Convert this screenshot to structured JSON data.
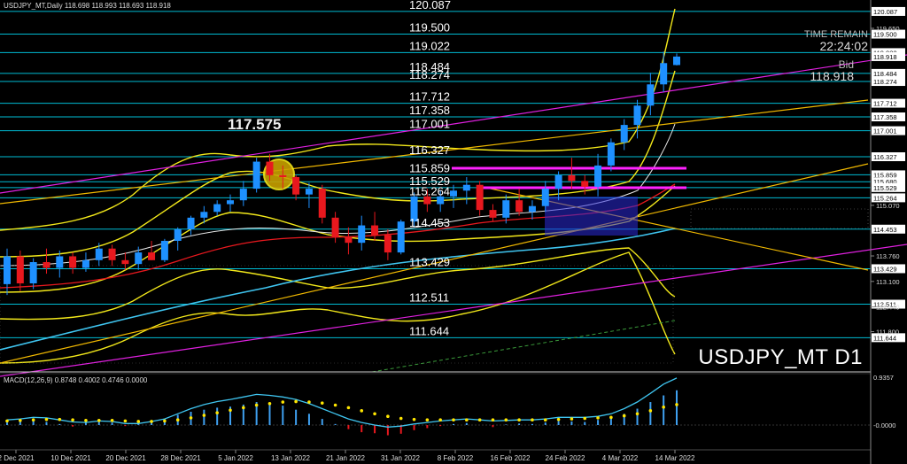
{
  "header": {
    "symbol_info": "USDJPY_MT,Daily  118.698 118.993 118.693 118.918"
  },
  "timer": {
    "label": "TIME REMAIN",
    "value": "22:24:02"
  },
  "bid": {
    "label": "Bid",
    "value": "118.918"
  },
  "watermark": "USDJPY_MT D1",
  "annotations": {
    "high_label": "117.575"
  },
  "macd": {
    "label": "MACD(12,26,9) 0.8748 0.4002 0.4746 0.0000",
    "top_value": "0.9357",
    "zero_value": "-0.0000"
  },
  "colors": {
    "background": "#000000",
    "bull_candle": "#1e90ff",
    "bear_candle": "#e8181e",
    "level_line": "#00bcd4",
    "bollinger": "#f2e81a",
    "trend_magenta": "#e020e0",
    "trend_orange": "#f0b800",
    "macd_signal": "#ffe600",
    "macd_line": "#3fc5f0",
    "price_scale_bg": "#ffffff"
  },
  "chart_data": {
    "type": "candlestick",
    "timeframe": "Daily",
    "symbol": "USDJPY_MT",
    "ylim": [
      110.85,
      120.2
    ],
    "horizontal_levels": [
      {
        "price": 120.087,
        "label": "120.087",
        "scale": "120.087"
      },
      {
        "price": 119.5,
        "label": "119.500",
        "scale": "119.500"
      },
      {
        "price": 119.022,
        "label": "119.022",
        "scale": "119.022"
      },
      {
        "price": 118.484,
        "label": "118.484",
        "scale": "118.484"
      },
      {
        "price": 118.274,
        "label": "118.274",
        "scale": "118.274"
      },
      {
        "price": 117.712,
        "label": "117.712",
        "scale": "117.712"
      },
      {
        "price": 117.358,
        "label": "117.358",
        "scale": "117.358"
      },
      {
        "price": 117.001,
        "label": "117.001",
        "scale": "117.001"
      },
      {
        "price": 116.327,
        "label": "116.327",
        "scale": "116.327"
      },
      {
        "price": 115.859,
        "label": "115.859",
        "scale": "115.859"
      },
      {
        "price": 115.68,
        "label": "",
        "scale": "115.680"
      },
      {
        "price": 115.529,
        "label": "115.529",
        "scale": "115.529"
      },
      {
        "price": 115.264,
        "label": "115.264",
        "scale": "115.264"
      },
      {
        "price": 114.453,
        "label": "114.453",
        "scale": "114.453"
      },
      {
        "price": 113.429,
        "label": "113.429",
        "scale": "113.429"
      },
      {
        "price": 112.511,
        "label": "112.511",
        "scale": "112.511"
      },
      {
        "price": 111.644,
        "label": "111.644",
        "scale": "111.644"
      }
    ],
    "plain_scale_ticks": [
      {
        "price": 119.65,
        "label": "119.650"
      },
      {
        "price": 115.07,
        "label": "115.070"
      },
      {
        "price": 113.76,
        "label": "113.760"
      },
      {
        "price": 113.1,
        "label": "113.100"
      },
      {
        "price": 112.44,
        "label": "112.440"
      },
      {
        "price": 111.8,
        "label": "111.800"
      }
    ],
    "current_price": {
      "price": 118.918,
      "label": "118.918"
    },
    "x_labels": [
      "2 Dec 2021",
      "10 Dec 2021",
      "20 Dec 2021",
      "28 Dec 2021",
      "5 Jan 2022",
      "13 Jan 2022",
      "21 Jan 2022",
      "31 Jan 2022",
      "8 Feb 2022",
      "16 Feb 2022",
      "24 Feb 2022",
      "4 Mar 2022",
      "14 Mar 2022"
    ],
    "candles": [
      [
        113.03,
        113.95,
        112.75,
        113.75
      ],
      [
        113.75,
        113.9,
        112.85,
        113.05
      ],
      [
        113.05,
        113.7,
        112.9,
        113.6
      ],
      [
        113.6,
        113.95,
        113.3,
        113.45
      ],
      [
        113.45,
        113.9,
        113.2,
        113.75
      ],
      [
        113.75,
        113.85,
        113.3,
        113.45
      ],
      [
        113.45,
        113.85,
        113.35,
        113.65
      ],
      [
        113.65,
        114.1,
        113.5,
        113.95
      ],
      [
        113.95,
        114.05,
        113.5,
        113.65
      ],
      [
        113.65,
        113.85,
        113.4,
        113.55
      ],
      [
        113.55,
        114.0,
        113.4,
        113.85
      ],
      [
        113.85,
        114.15,
        113.65,
        113.65
      ],
      [
        113.65,
        114.2,
        113.6,
        114.15
      ],
      [
        114.15,
        114.5,
        113.9,
        114.45
      ],
      [
        114.45,
        114.8,
        114.3,
        114.75
      ],
      [
        114.75,
        115.05,
        114.6,
        114.9
      ],
      [
        114.9,
        115.2,
        114.8,
        115.1
      ],
      [
        115.1,
        115.35,
        114.9,
        115.2
      ],
      [
        115.2,
        115.7,
        115.05,
        115.5
      ],
      [
        115.5,
        116.3,
        115.4,
        116.2
      ],
      [
        116.2,
        116.4,
        115.7,
        115.85
      ],
      [
        115.85,
        116.1,
        115.5,
        115.8
      ],
      [
        115.8,
        115.85,
        115.2,
        115.35
      ],
      [
        115.35,
        115.65,
        115.0,
        115.5
      ],
      [
        115.5,
        115.6,
        114.6,
        114.75
      ],
      [
        114.75,
        114.9,
        114.1,
        114.25
      ],
      [
        114.25,
        114.5,
        113.8,
        114.1
      ],
      [
        114.1,
        114.8,
        113.9,
        114.55
      ],
      [
        114.55,
        114.9,
        114.15,
        114.3
      ],
      [
        114.3,
        114.45,
        113.65,
        113.85
      ],
      [
        113.85,
        114.7,
        113.8,
        114.65
      ],
      [
        114.65,
        115.4,
        114.5,
        115.3
      ],
      [
        115.3,
        115.5,
        114.9,
        115.1
      ],
      [
        115.1,
        115.45,
        114.9,
        115.3
      ],
      [
        115.3,
        115.6,
        115.0,
        115.45
      ],
      [
        115.45,
        115.8,
        115.1,
        115.6
      ],
      [
        115.6,
        115.7,
        114.8,
        114.95
      ],
      [
        114.95,
        115.1,
        114.65,
        114.75
      ],
      [
        114.75,
        115.35,
        114.6,
        115.2
      ],
      [
        115.2,
        115.5,
        114.8,
        114.9
      ],
      [
        114.9,
        115.2,
        114.7,
        115.05
      ],
      [
        115.05,
        115.7,
        114.9,
        115.5
      ],
      [
        115.5,
        115.95,
        115.2,
        115.85
      ],
      [
        115.85,
        116.3,
        115.5,
        115.7
      ],
      [
        115.7,
        115.85,
        115.35,
        115.55
      ],
      [
        115.55,
        116.4,
        115.3,
        116.1
      ],
      [
        116.1,
        116.8,
        115.95,
        116.7
      ],
      [
        116.7,
        117.3,
        116.5,
        117.15
      ],
      [
        117.15,
        117.8,
        116.8,
        117.65
      ],
      [
        117.65,
        118.5,
        117.4,
        118.2
      ],
      [
        118.2,
        119.05,
        118.0,
        118.75
      ],
      [
        118.7,
        119.0,
        118.69,
        118.92
      ]
    ]
  }
}
